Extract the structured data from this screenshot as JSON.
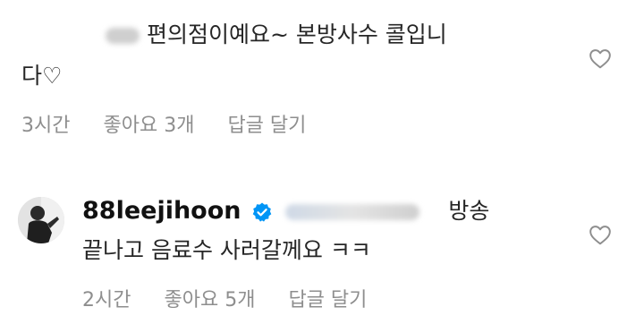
{
  "comments": [
    {
      "line1_text": "편의점이예요~ 본방사수 콜입니",
      "line2_text": "다♡",
      "time": "3시간",
      "likes": "좋아요 3개",
      "reply": "답글 달기",
      "like_icon": "heart-outline-icon"
    },
    {
      "username": "88leejihoon",
      "verified_icon": "verified-badge-icon",
      "line1_text": "방송",
      "line2_text": "끝나고 음료수 사러갈께요 ㅋㅋ",
      "time": "2시간",
      "likes": "좋아요 5개",
      "reply": "답글 달기",
      "like_icon": "heart-outline-icon"
    }
  ],
  "colors": {
    "text": "#262626",
    "meta": "#8e8e8e",
    "verified": "#0095f6"
  }
}
